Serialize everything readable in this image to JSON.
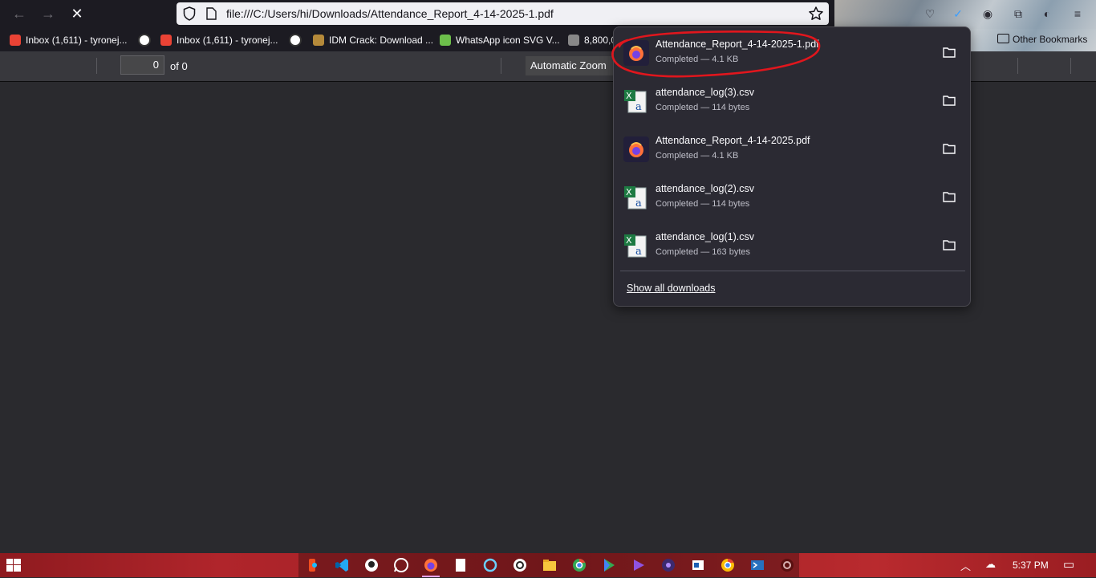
{
  "browser": {
    "url": "file:///C:/Users/hi/Downloads/Attendance_Report_4-14-2025-1.pdf",
    "back_icon": "←",
    "forward_icon": "→",
    "stop_icon": "✕"
  },
  "bookmarks": [
    {
      "label": "Inbox (1,611) - tyronej...",
      "icon": "gmail-icon",
      "color": "#ea4335"
    },
    {
      "label": "Inbox (1,611) - tyronej...",
      "icon": "gmail-icon",
      "color": "#ea4335"
    },
    {
      "label": "IDM Crack: Download ...",
      "icon": "idm-icon",
      "color": "#b58a3a"
    },
    {
      "label": "WhatsApp icon SVG V...",
      "icon": "svgrepo-icon",
      "color": "#6dbf4b"
    },
    {
      "label": "8,800,0",
      "icon": "site-icon",
      "color": "#888888"
    }
  ],
  "other_bookmarks": "Other Bookmarks",
  "pdf_toolbar": {
    "page_value": "0",
    "page_count": "of 0",
    "zoom": "Automatic Zoom"
  },
  "downloads": {
    "items": [
      {
        "name": "Attendance_Report_4-14-2025-1.pdf",
        "status": "Completed — 4.1 KB",
        "type": "pdf"
      },
      {
        "name": "attendance_log(3).csv",
        "status": "Completed — 114 bytes",
        "type": "csv"
      },
      {
        "name": "Attendance_Report_4-14-2025.pdf",
        "status": "Completed — 4.1 KB",
        "type": "pdf"
      },
      {
        "name": "attendance_log(2).csv",
        "status": "Completed — 114 bytes",
        "type": "csv"
      },
      {
        "name": "attendance_log(1).csv",
        "status": "Completed — 163 bytes",
        "type": "csv"
      }
    ],
    "show_all": "Show all downloads",
    "highlight_color": "#e0161d"
  },
  "taskbar": {
    "time": "5:37 PM",
    "apps": [
      "figma-icon",
      "vscode-icon",
      "github-icon",
      "whatsapp-icon",
      "firefox-icon",
      "notepad-icon",
      "circle-app-icon",
      "chatgpt-icon",
      "file-explorer-icon",
      "chrome-icon",
      "google-play-icon",
      "visual-studio-icon",
      "game-icon",
      "app-icon",
      "chrome-icon",
      "powershell-icon",
      "gear-app-icon"
    ],
    "active_app": "firefox-icon"
  }
}
